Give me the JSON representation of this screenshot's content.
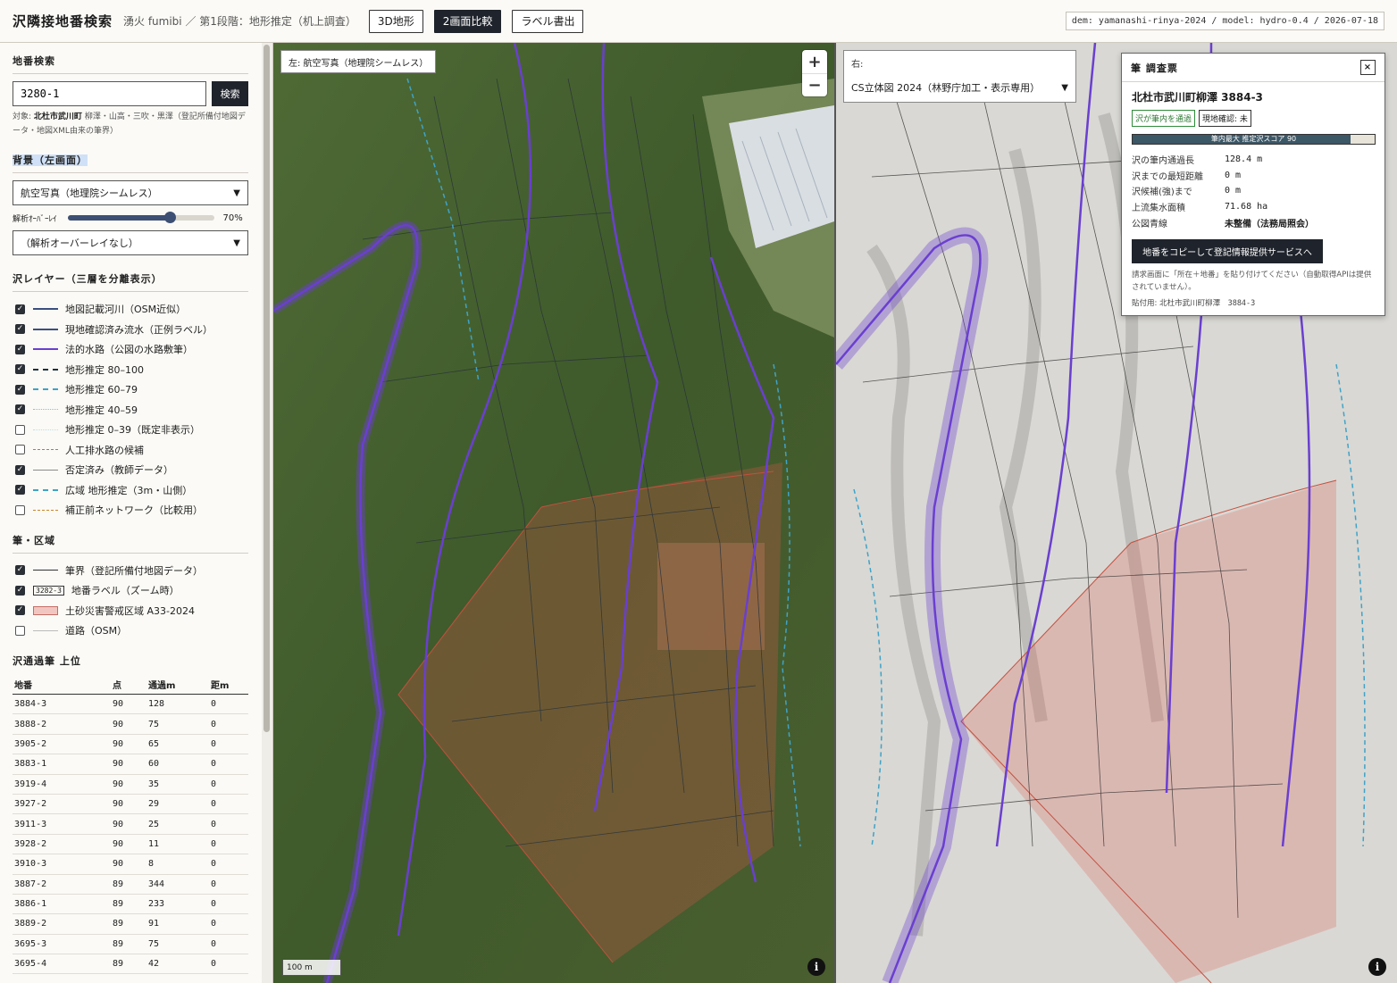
{
  "header": {
    "title": "沢隣接地番検索",
    "subtitle": "湧火 fumibi ／ 第1段階：地形推定（机上調査）",
    "buttons": [
      "3D地形",
      "2画面比較",
      "ラベル書出"
    ],
    "active_button": 1,
    "meta": "dem: yamanashi-rinya-2024 / model: hydro-0.4 / 2026-07-18"
  },
  "search": {
    "title": "地番検索",
    "value": "3280-1",
    "button": "検索",
    "target_label": "対象:",
    "target_strong": "北杜市武川町",
    "target_rest": "柳澤・山高・三吹・黒澤（登記所備付地図データ・地図XML由来の筆界）"
  },
  "background": {
    "title": "背景（左画面）",
    "base_select": "航空写真（地理院シームレス）",
    "opacity_label": "解析ｵｰﾊﾞｰﾚｲ",
    "opacity_value": "70%",
    "opacity_fraction": 0.7,
    "overlay_select": "（解析オーバーレイなし）"
  },
  "stream_layers": {
    "title": "沢レイヤー（三層を分離表示）",
    "items": [
      {
        "label": "地図記載河川（OSM近似）",
        "checked": true,
        "color": "#3b4f80",
        "style": "solid",
        "width": 2
      },
      {
        "label": "現地確認済み流水（正例ラベル）",
        "checked": true,
        "color": "#3b4f80",
        "style": "solid",
        "width": 2
      },
      {
        "label": "法的水路（公図の水路敷筆）",
        "checked": true,
        "color": "#6a3fd0",
        "style": "solid",
        "width": 2
      },
      {
        "label": "地形推定 80–100",
        "checked": true,
        "color": "#1b3042",
        "style": "dashed",
        "width": 2
      },
      {
        "label": "地形推定 60–79",
        "checked": true,
        "color": "#3ea3c8",
        "style": "dashed",
        "width": 2
      },
      {
        "label": "地形推定 40–59",
        "checked": true,
        "color": "#7fc0de",
        "style": "dotted",
        "width": 1
      },
      {
        "label": "地形推定 0–39（既定非表示）",
        "checked": false,
        "color": "#bcdcec",
        "style": "dotted",
        "width": 1
      },
      {
        "label": "人工排水路の候補",
        "checked": false,
        "color": "#4aa38a",
        "style": "dashed",
        "width": 1
      },
      {
        "label": "否定済み（教師データ）",
        "checked": true,
        "color": "#8a8a8a",
        "style": "solid",
        "width": 1
      },
      {
        "label": "広域 地形推定（3m・山側）",
        "checked": true,
        "color": "#3ea3c8",
        "style": "dashed",
        "width": 2
      },
      {
        "label": "補正前ネットワーク（比較用）",
        "checked": false,
        "color": "#c9852a",
        "style": "dashed",
        "width": 1
      }
    ]
  },
  "parcel_layers": {
    "title": "筆・区域",
    "items": [
      {
        "label": "筆界（登記所備付地図データ）",
        "checked": true,
        "kind": "line",
        "color": "#333333"
      },
      {
        "label": "地番ラベル（ズーム時）",
        "checked": true,
        "kind": "tag",
        "tag": "3282-3"
      },
      {
        "label": "土砂災害警戒区域 A33-2024",
        "checked": true,
        "kind": "box"
      },
      {
        "label": "道路（OSM）",
        "checked": false,
        "kind": "line",
        "color": "#bbbbbb"
      }
    ]
  },
  "top_table": {
    "title": "沢通過筆 上位",
    "columns": [
      "地番",
      "点",
      "通過m",
      "距m"
    ],
    "rows": [
      [
        "3884-3",
        "90",
        "128",
        "0"
      ],
      [
        "3888-2",
        "90",
        "75",
        "0"
      ],
      [
        "3905-2",
        "90",
        "65",
        "0"
      ],
      [
        "3883-1",
        "90",
        "60",
        "0"
      ],
      [
        "3919-4",
        "90",
        "35",
        "0"
      ],
      [
        "3927-2",
        "90",
        "29",
        "0"
      ],
      [
        "3911-3",
        "90",
        "25",
        "0"
      ],
      [
        "3928-2",
        "90",
        "11",
        "0"
      ],
      [
        "3910-3",
        "90",
        "8",
        "0"
      ],
      [
        "3887-2",
        "89",
        "344",
        "0"
      ],
      [
        "3886-1",
        "89",
        "233",
        "0"
      ],
      [
        "3889-2",
        "89",
        "91",
        "0"
      ],
      [
        "3695-3",
        "89",
        "75",
        "0"
      ],
      [
        "3695-4",
        "89",
        "42",
        "0"
      ]
    ]
  },
  "map_left": {
    "label": "左: 航空写真（地理院シームレス）",
    "zoom_in": "+",
    "zoom_out": "−",
    "scale": "100 m",
    "info": "i"
  },
  "map_right": {
    "label": "右:",
    "select": "CS立体図 2024（林野庁加工・表示専用）",
    "info": "i"
  },
  "popup": {
    "title": "筆 調査票",
    "close": "×",
    "parcel": "北杜市武川町柳澤 3884-3",
    "badge_pass": "沢が筆内を通過",
    "badge_field": "現地確認: 未",
    "score_text": "筆内最大 推定沢スコア 90",
    "score_fraction": 0.9,
    "fields": [
      {
        "k": "沢の筆内通過長",
        "v": "128.4 m"
      },
      {
        "k": "沢までの最短距離",
        "v": "0 m"
      },
      {
        "k": "沢候補(強)まで",
        "v": "0 m"
      },
      {
        "k": "上流集水面積",
        "v": "71.68 ha"
      },
      {
        "k": "公図青線",
        "v": "未整備（法務局照会）"
      }
    ],
    "copy_button": "地番をコピーして登記情報提供サービスへ",
    "note": "請求画面に「所在＋地番」を貼り付けてください（自動取得APIは提供されていません）。",
    "paste_label": "貼付用:",
    "paste_value": "北杜市武川町柳澤　3884-3"
  },
  "colors": {
    "legal_channel": "#6a3fd0",
    "hazard_fill": "#e0574a",
    "estimated_stream": "#3ea3c8"
  }
}
